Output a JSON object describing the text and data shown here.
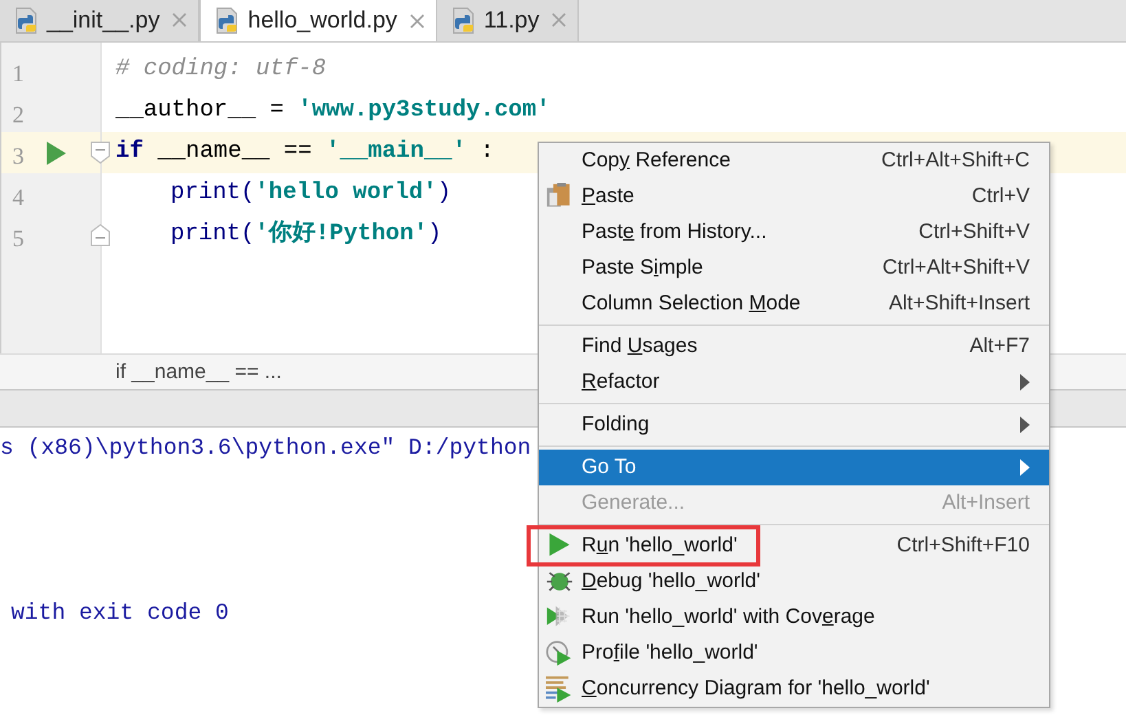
{
  "tabs": [
    {
      "label": "__init__.py",
      "selected": false
    },
    {
      "label": "hello_world.py",
      "selected": true
    },
    {
      "label": "11.py",
      "selected": false
    }
  ],
  "editor": {
    "lines": [
      {
        "number": "1",
        "current": false,
        "run_marker": false,
        "indented": false,
        "fold_start": false,
        "fold_end": false,
        "tokens": [
          {
            "kind": "comment",
            "text": "# coding: utf-8"
          }
        ]
      },
      {
        "number": "2",
        "current": false,
        "run_marker": false,
        "indented": false,
        "fold_start": false,
        "fold_end": false,
        "tokens": [
          {
            "kind": "plain",
            "text": "__author__ = "
          },
          {
            "kind": "string",
            "text": "'www.py3study.com'"
          }
        ]
      },
      {
        "number": "3",
        "current": true,
        "run_marker": true,
        "indented": false,
        "fold_start": true,
        "fold_end": false,
        "tokens": [
          {
            "kind": "keyword",
            "text": "if"
          },
          {
            "kind": "plain",
            "text": " __name__ == "
          },
          {
            "kind": "string",
            "text": "'__main__'"
          },
          {
            "kind": "plain",
            "text": " :"
          }
        ]
      },
      {
        "number": "4",
        "current": false,
        "run_marker": false,
        "indented": true,
        "fold_start": false,
        "fold_end": false,
        "tokens": [
          {
            "kind": "builtin",
            "text": "print("
          },
          {
            "kind": "string",
            "text": "'hello world'"
          },
          {
            "kind": "builtin",
            "text": ")"
          }
        ]
      },
      {
        "number": "5",
        "current": false,
        "run_marker": false,
        "indented": true,
        "fold_start": false,
        "fold_end": true,
        "tokens": [
          {
            "kind": "builtin",
            "text": "print("
          },
          {
            "kind": "string",
            "text": "'你好!Python'"
          },
          {
            "kind": "builtin",
            "text": ")"
          }
        ]
      }
    ],
    "breadcrumb": "if __name__ == ..."
  },
  "console": {
    "lines": [
      "s (x86)\\python3.6\\python.exe\" D:/python",
      "with exit code 0"
    ]
  },
  "context_menu": {
    "items": [
      {
        "kind": "item",
        "before": "Cop",
        "mnemonic": "y",
        "after": " Reference",
        "shortcut": "Ctrl+Alt+Shift+C",
        "selected": false,
        "disabled": false,
        "submenu": false,
        "outlined": false
      },
      {
        "kind": "item",
        "mnemonic": "P",
        "after": "aste",
        "shortcut": "Ctrl+V",
        "selected": false,
        "disabled": false,
        "submenu": false,
        "outlined": false
      },
      {
        "kind": "item",
        "before": "Past",
        "mnemonic": "e",
        "after": " from History...",
        "shortcut": "Ctrl+Shift+V",
        "selected": false,
        "disabled": false,
        "submenu": false,
        "outlined": false
      },
      {
        "kind": "item",
        "before": "Paste S",
        "mnemonic": "i",
        "after": "mple",
        "shortcut": "Ctrl+Alt+Shift+V",
        "selected": false,
        "disabled": false,
        "submenu": false,
        "outlined": false
      },
      {
        "kind": "item",
        "before": "Column Selection ",
        "mnemonic": "M",
        "after": "ode",
        "shortcut": "Alt+Shift+Insert",
        "selected": false,
        "disabled": false,
        "submenu": false,
        "outlined": false
      },
      {
        "kind": "separator"
      },
      {
        "kind": "item",
        "before": "Find ",
        "mnemonic": "U",
        "after": "sages",
        "shortcut": "Alt+F7",
        "selected": false,
        "disabled": false,
        "submenu": false,
        "outlined": false
      },
      {
        "kind": "item",
        "mnemonic": "R",
        "after": "efactor",
        "selected": false,
        "disabled": false,
        "submenu": true,
        "outlined": false
      },
      {
        "kind": "separator"
      },
      {
        "kind": "item",
        "text": "Folding",
        "selected": false,
        "disabled": false,
        "submenu": true,
        "outlined": false
      },
      {
        "kind": "separator"
      },
      {
        "kind": "item",
        "text": "Go To",
        "selected": true,
        "disabled": false,
        "submenu": true,
        "outlined": false
      },
      {
        "kind": "item",
        "text": "Generate...",
        "shortcut": "Alt+Insert",
        "selected": false,
        "disabled": true,
        "submenu": false,
        "outlined": false
      },
      {
        "kind": "separator"
      },
      {
        "kind": "item",
        "before": "R",
        "mnemonic": "u",
        "after": "n 'hello_world'",
        "shortcut": "Ctrl+Shift+F10",
        "selected": false,
        "disabled": false,
        "submenu": false,
        "outlined": true
      },
      {
        "kind": "item",
        "mnemonic": "D",
        "after": "ebug 'hello_world'",
        "selected": false,
        "disabled": false,
        "submenu": false,
        "outlined": false
      },
      {
        "kind": "item",
        "before": "Run 'hello_world' with Cov",
        "mnemonic": "e",
        "after": "rage",
        "selected": false,
        "disabled": false,
        "submenu": false,
        "outlined": false
      },
      {
        "kind": "item",
        "before": "Pro",
        "mnemonic": "f",
        "after": "ile 'hello_world'",
        "selected": false,
        "disabled": false,
        "submenu": false,
        "outlined": false
      },
      {
        "kind": "item",
        "mnemonic": "C",
        "after": "oncurrency Diagram for  'hello_world'",
        "selected": false,
        "disabled": false,
        "submenu": false,
        "outlined": false
      }
    ]
  }
}
